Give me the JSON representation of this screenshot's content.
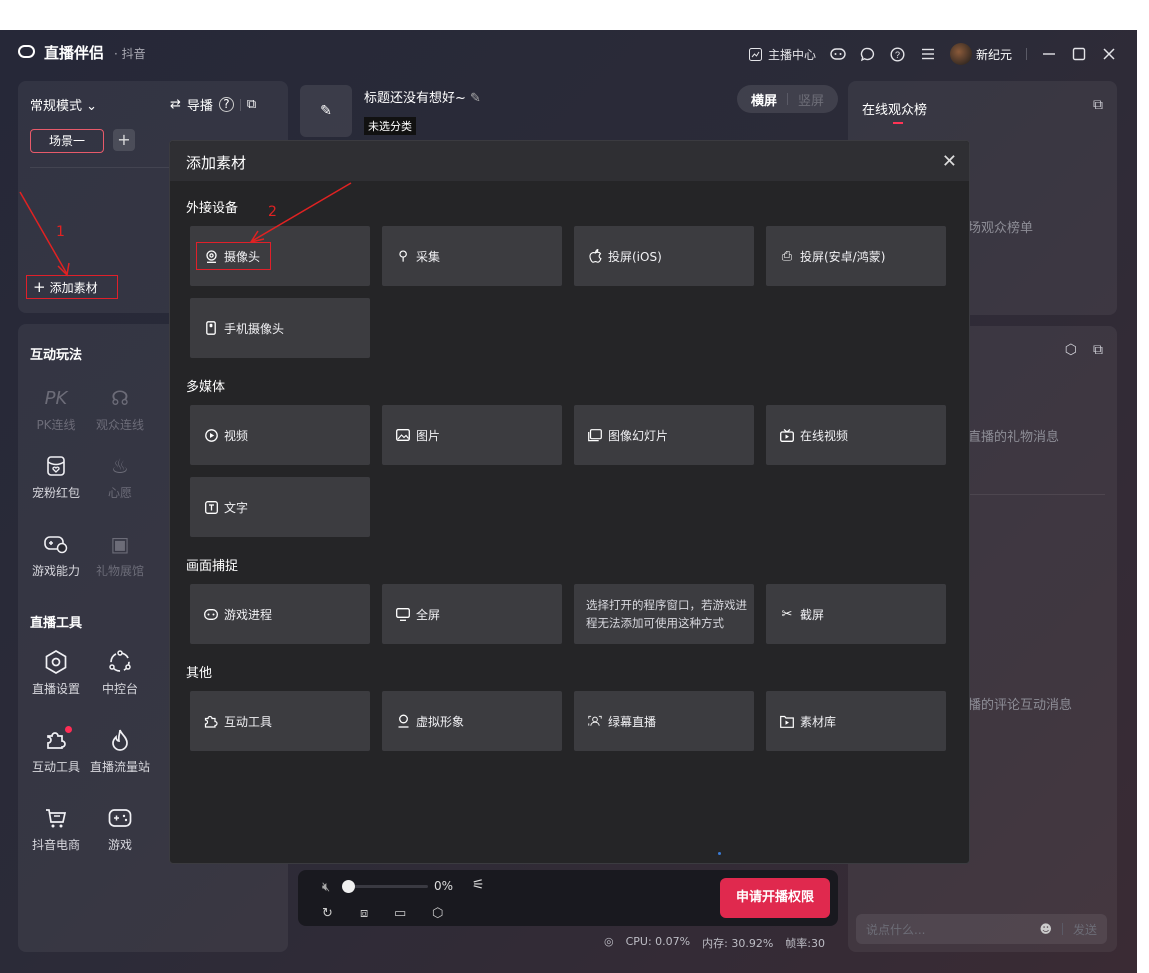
{
  "titlebar": {
    "app_name": "直播伴侣",
    "platform": "· 抖音",
    "anchor_center": "主播中心",
    "username": "新纪元"
  },
  "left_top": {
    "mode": "常规模式",
    "guide": "导播",
    "scene_tab": "场景一",
    "add_material": "添加素材"
  },
  "left_bottom": {
    "interactive_title": "互动玩法",
    "interactive_items": [
      {
        "label": "PK连线",
        "icon": "pk-icon"
      },
      {
        "label": "观众连线",
        "icon": "audience-link-icon"
      },
      {
        "label": "宠粉红包",
        "icon": "red-packet-icon"
      },
      {
        "label": "心愿",
        "icon": "wish-icon"
      },
      {
        "label": "游戏能力",
        "icon": "gamepad-plus-icon"
      },
      {
        "label": "礼物展馆",
        "icon": "gift-hall-icon"
      }
    ],
    "tools_title": "直播工具",
    "tool_items": [
      {
        "label": "直播设置",
        "icon": "hexagon-settings-icon"
      },
      {
        "label": "中控台",
        "icon": "control-icon"
      },
      {
        "label": "互动工具",
        "icon": "puzzle-icon"
      },
      {
        "label": "直播流量站",
        "icon": "flame-icon"
      },
      {
        "label": "抖音电商",
        "icon": "cart-icon"
      },
      {
        "label": "游戏",
        "icon": "gamepad-icon"
      }
    ]
  },
  "center_top": {
    "live_title": "标题还没有想好~",
    "category": "未选分类",
    "landscape": "横屏",
    "portrait": "竖屏"
  },
  "right_top": {
    "title": "在线观众榜",
    "hint": "场观众榜单"
  },
  "right_bottom": {
    "gift_hint": "直播的礼物消息",
    "comment_hint": "播的评论互动消息",
    "chat_placeholder": "说点什么...",
    "send": "发送"
  },
  "control_bar": {
    "volume": "0%",
    "apply_button": "申请开播权限"
  },
  "status": {
    "cpu": "CPU: 0.07%",
    "memory": "内存: 30.92%",
    "fps": "帧率:30"
  },
  "modal": {
    "title": "添加素材",
    "groups": [
      {
        "title": "外接设备",
        "items": [
          {
            "label": "摄像头",
            "icon": "camera-icon"
          },
          {
            "label": "采集",
            "icon": "capture-icon"
          },
          {
            "label": "投屏(iOS)",
            "icon": "apple-icon"
          },
          {
            "label": "投屏(安卓/鸿蒙)",
            "icon": "android-icon"
          },
          {
            "label": "手机摄像头",
            "icon": "phone-icon"
          }
        ]
      },
      {
        "title": "多媒体",
        "items": [
          {
            "label": "视频",
            "icon": "play-icon"
          },
          {
            "label": "图片",
            "icon": "image-icon"
          },
          {
            "label": "图像幻灯片",
            "icon": "slideshow-icon"
          },
          {
            "label": "在线视频",
            "icon": "tv-icon"
          },
          {
            "label": "文字",
            "icon": "text-icon"
          }
        ]
      },
      {
        "title": "画面捕捉",
        "items": [
          {
            "label": "游戏进程",
            "icon": "gamepad-icon"
          },
          {
            "label": "全屏",
            "icon": "monitor-icon"
          },
          {
            "label": "选择打开的程序窗口，若游戏进程无法添加可使用这种方式",
            "icon": ""
          },
          {
            "label": "截屏",
            "icon": "scissors-icon"
          }
        ]
      },
      {
        "title": "其他",
        "items": [
          {
            "label": "互动工具",
            "icon": "puzzle-icon"
          },
          {
            "label": "虚拟形象",
            "icon": "avatar-icon"
          },
          {
            "label": "绿幕直播",
            "icon": "greenscreen-icon"
          },
          {
            "label": "素材库",
            "icon": "library-icon"
          }
        ]
      }
    ]
  },
  "annotations": {
    "one": "1",
    "two": "2"
  },
  "colors": {
    "accent": "#e0294e",
    "highlight": "#e0202a"
  }
}
